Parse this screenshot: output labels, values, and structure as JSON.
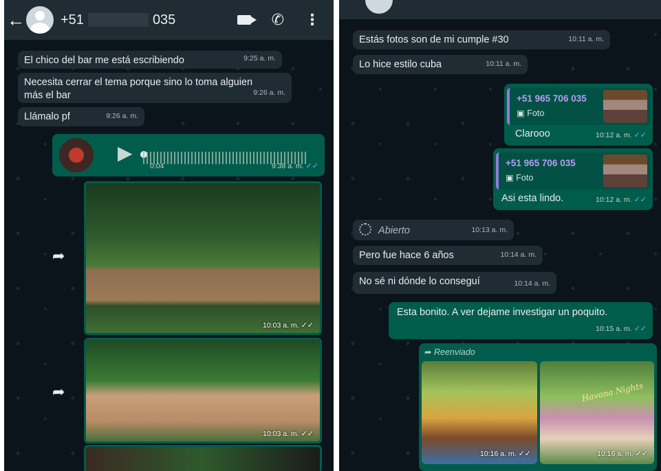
{
  "left": {
    "header": {
      "phone_prefix": "+51",
      "phone_suffix": "035"
    },
    "messages": [
      {
        "text": "El chico del bar me está escribiendo",
        "time": "9:25 a. m."
      },
      {
        "text": "Necesita cerrar el tema porque sino lo toma alguien más el bar",
        "time": "9:26 a. m."
      },
      {
        "text": "Llámalo pf",
        "time": "9:26 a. m."
      }
    ],
    "voice": {
      "duration": "0:04",
      "time": "9:38 a. m."
    },
    "photos": [
      {
        "time": "10:03 a. m."
      },
      {
        "time": "10:03 a. m."
      }
    ]
  },
  "right": {
    "messages": [
      {
        "text": "Estás fotos son de mi cumple #30",
        "time": "10:11 a. m."
      },
      {
        "text": "Lo hice estilo cuba",
        "time": "10:11 a. m."
      }
    ],
    "replies": [
      {
        "quoted_name": "+51 965 706 035",
        "quoted_type": "Foto",
        "text": "Clarooo",
        "time": "10:12 a. m."
      },
      {
        "quoted_name": "+51 965 706 035",
        "quoted_type": "Foto",
        "text": "Asi esta lindo.",
        "time": "10:12 a. m."
      }
    ],
    "view_once": {
      "text": "Abierto",
      "time": "10:13 a. m."
    },
    "messages2": [
      {
        "text": "Pero fue hace 6 años",
        "time": "10:14 a. m."
      },
      {
        "text": "No sé ni dónde lo conseguí",
        "time": "10:14 a. m."
      }
    ],
    "outgoing": {
      "text": "Esta bonito. A ver dejame investigar un poquito.",
      "time": "10:15 a. m."
    },
    "forwarded": {
      "label": "Reenviado",
      "photo_times": [
        "10:16 a. m.",
        "10:16 a. m."
      ],
      "decor_text": "Havana Nights"
    }
  },
  "colors": {
    "incoming": "#202c33",
    "outgoing": "#005c4b",
    "header": "#1f2c33",
    "background": "#0b141a",
    "tick": "#53bdeb"
  }
}
